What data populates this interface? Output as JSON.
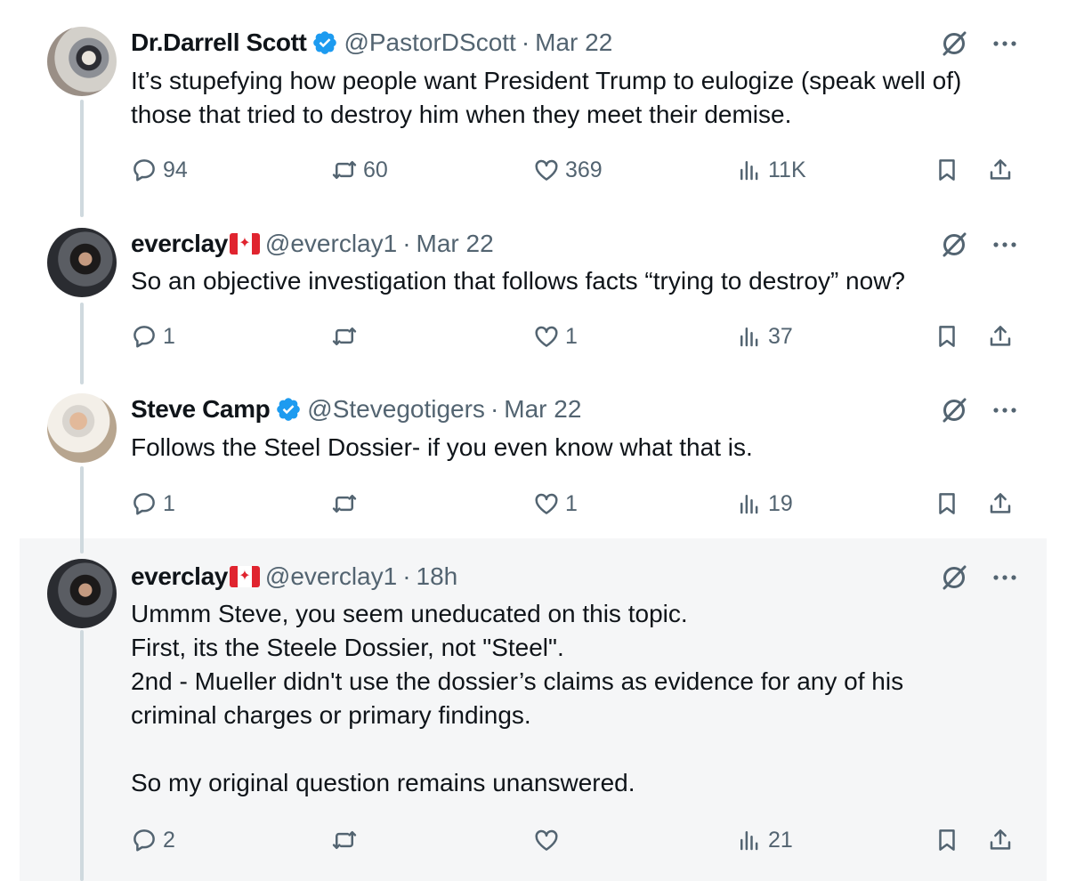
{
  "tweets": [
    {
      "name": "Dr.Darrell Scott",
      "verified": true,
      "flag": false,
      "handle": "@PastorDScott",
      "sep": "·",
      "date": "Mar 22",
      "lines": [
        "It’s stupefying how people want President Trump to eulogize (speak well of)",
        "those that tried to destroy him when they meet their demise."
      ],
      "replies": "94",
      "reposts": "60",
      "likes": "369",
      "views": "11K"
    },
    {
      "name": "everclay",
      "verified": false,
      "flag": true,
      "handle": "@everclay1",
      "sep": "·",
      "date": "Mar 22",
      "lines": [
        "So an objective investigation that follows facts “trying to destroy” now?"
      ],
      "replies": "1",
      "reposts": "",
      "likes": "1",
      "views": "37"
    },
    {
      "name": "Steve Camp",
      "verified": true,
      "flag": false,
      "handle": "@Stevegotigers",
      "sep": "·",
      "date": "Mar 22",
      "lines": [
        "Follows the Steel Dossier- if you even know what that is."
      ],
      "replies": "1",
      "reposts": "",
      "likes": "1",
      "views": "19"
    },
    {
      "name": "everclay",
      "verified": false,
      "flag": true,
      "handle": "@everclay1",
      "sep": "·",
      "date": "18h",
      "lines": [
        "Ummm Steve, you seem uneducated on this topic.",
        "First, its the Steele Dossier, not \"Steel\".",
        "2nd - Mueller didn't use the dossier’s claims as evidence for any of his",
        "criminal charges or primary findings.",
        "",
        "So my original question remains unanswered."
      ],
      "replies": "2",
      "reposts": "",
      "likes": "",
      "views": "21"
    }
  ],
  "icons": {
    "verified": "verified-badge-icon",
    "flag": "canada-flag-icon",
    "grok": "grok-icon",
    "more": "more-icon",
    "reply": "reply-icon",
    "repost": "repost-icon",
    "like": "like-icon",
    "views": "views-icon",
    "bookmark": "bookmark-icon",
    "share": "share-icon"
  },
  "colors": {
    "verified": "#1d9bf0",
    "text": "#0f1419",
    "secondary": "#536471",
    "thread_line": "#cfd9de",
    "highlight_bg": "#f5f6f7",
    "flag_red": "#e0242f"
  }
}
